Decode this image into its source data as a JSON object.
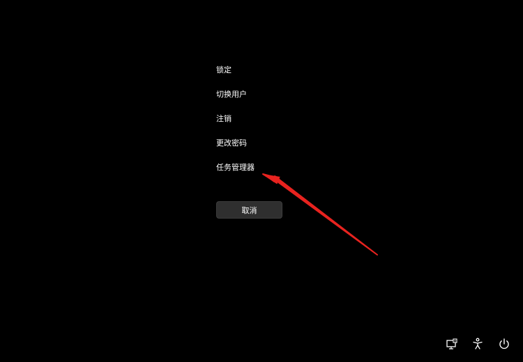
{
  "menu": {
    "items": [
      {
        "label": "锁定"
      },
      {
        "label": "切换用户"
      },
      {
        "label": "注销"
      },
      {
        "label": "更改密码"
      },
      {
        "label": "任务管理器"
      }
    ]
  },
  "cancel_button": {
    "label": "取消"
  },
  "annotation": {
    "color": "#e8231f",
    "points_to": "任务管理器"
  },
  "tray": {
    "icons": [
      "network-monitor-icon",
      "accessibility-icon",
      "power-icon"
    ]
  },
  "colors": {
    "background": "#000000",
    "text": "#ffffff",
    "button_bg": "#2f2f2f"
  }
}
